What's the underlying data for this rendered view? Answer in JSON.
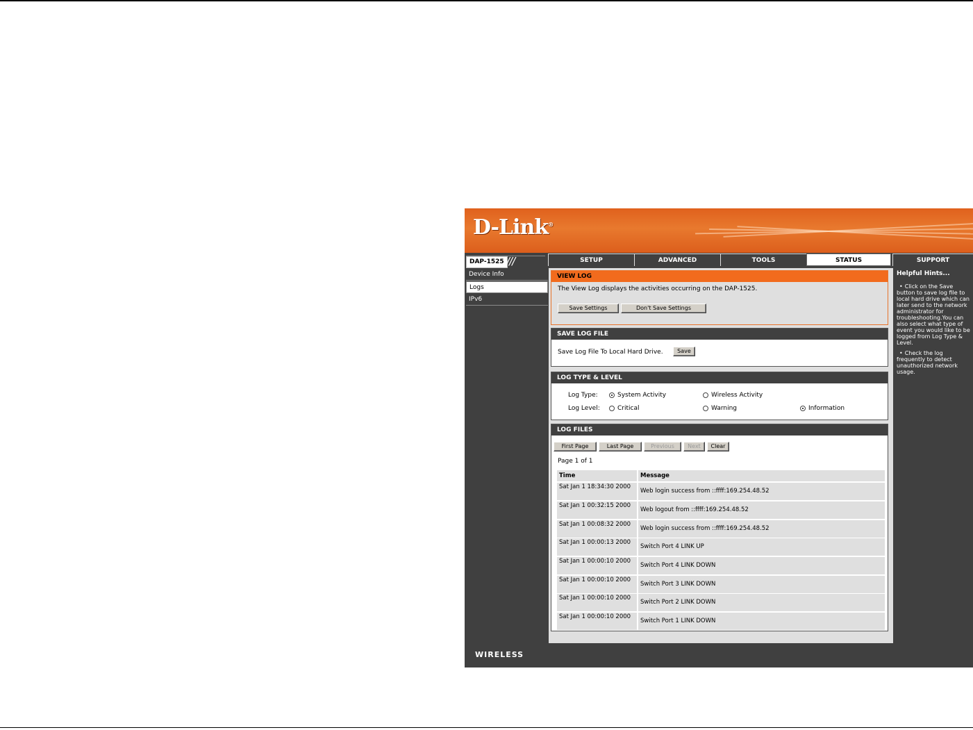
{
  "brand": {
    "logo": "D-Link",
    "registered": "®"
  },
  "model": "DAP-1525",
  "model_slashes": "///",
  "tabs": [
    {
      "label": "SETUP"
    },
    {
      "label": "ADVANCED"
    },
    {
      "label": "TOOLS"
    },
    {
      "label": "STATUS"
    },
    {
      "label": "SUPPORT"
    }
  ],
  "active_tab": "STATUS",
  "sidebar": {
    "items": [
      {
        "label": "Device Info"
      },
      {
        "label": "Logs"
      },
      {
        "label": "IPv6"
      }
    ],
    "active": "Logs"
  },
  "view_log": {
    "title": "VIEW LOG",
    "description": "The View Log displays the activities occurring on the DAP-1525.",
    "save_settings": "Save Settings",
    "dont_save_settings": "Don't Save Settings"
  },
  "save_log_file": {
    "title": "SAVE LOG FILE",
    "label": "Save Log File To Local Hard Drive.",
    "save_button": "Save"
  },
  "log_type_level": {
    "title": "LOG TYPE & LEVEL",
    "type_label": "Log Type:",
    "type_options": [
      {
        "label": "System Activity",
        "checked": true
      },
      {
        "label": "Wireless Activity",
        "checked": false
      }
    ],
    "level_label": "Log Level:",
    "level_options": [
      {
        "label": "Critical",
        "checked": false
      },
      {
        "label": "Warning",
        "checked": false
      },
      {
        "label": "Information",
        "checked": true
      }
    ]
  },
  "log_files": {
    "title": "LOG FILES",
    "buttons": {
      "first": "First Page",
      "last": "Last Page",
      "previous": "Previous",
      "next": "Next",
      "clear": "Clear"
    },
    "page_info": "Page 1 of 1",
    "columns": [
      "Time",
      "Message"
    ],
    "rows": [
      {
        "time": "Sat Jan 1 18:34:30 2000",
        "message": "Web login success from ::ffff:169.254.48.52"
      },
      {
        "time": "Sat Jan 1 00:32:15 2000",
        "message": "Web logout from ::ffff:169.254.48.52"
      },
      {
        "time": "Sat Jan 1 00:08:32 2000",
        "message": "Web login success from ::ffff:169.254.48.52"
      },
      {
        "time": "Sat Jan 1 00:00:13 2000",
        "message": "Switch Port 4 LINK UP"
      },
      {
        "time": "Sat Jan 1 00:00:10 2000",
        "message": "Switch Port 4 LINK DOWN"
      },
      {
        "time": "Sat Jan 1 00:00:10 2000",
        "message": "Switch Port 3 LINK DOWN"
      },
      {
        "time": "Sat Jan 1 00:00:10 2000",
        "message": "Switch Port 2 LINK DOWN"
      },
      {
        "time": "Sat Jan 1 00:00:10 2000",
        "message": "Switch Port 1 LINK DOWN"
      }
    ]
  },
  "hints": {
    "title": "Helpful Hints...",
    "bullet": "•",
    "items": [
      "Click on the Save button to save log file to local hard drive which can later send to the network administrator for troubleshooting.You can also select what type of event you would like to be logged from Log Type & Level.",
      "Check the log frequently to detect unauthorized network usage."
    ]
  },
  "footer": {
    "label": "WIRELESS"
  }
}
